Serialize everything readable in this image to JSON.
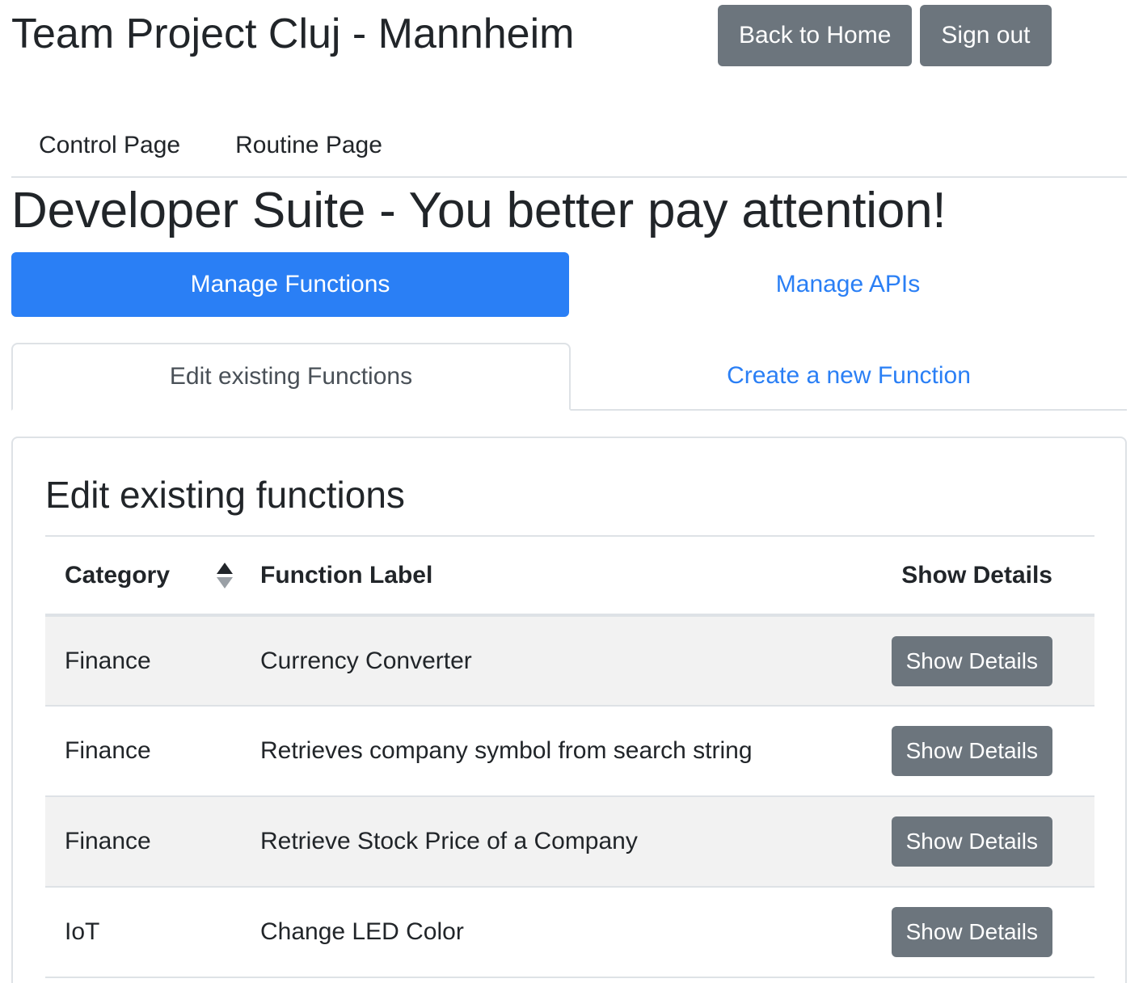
{
  "header": {
    "title": "Team Project Cluj - Mannheim",
    "back_home_label": "Back to Home",
    "sign_out_label": "Sign out"
  },
  "nav": {
    "items": [
      {
        "label": "Control Page"
      },
      {
        "label": "Routine Page"
      }
    ]
  },
  "suite_title": "Developer Suite - You better pay attention!",
  "pills": {
    "active_label": "Manage Functions",
    "inactive_label": "Manage APIs"
  },
  "tabs": {
    "active_label": "Edit existing Functions",
    "inactive_label": "Create a new Function"
  },
  "card": {
    "title": "Edit existing functions",
    "table": {
      "headers": {
        "category": "Category",
        "function_label": "Function Label",
        "show_details": "Show Details"
      },
      "sort_icon": "sort-icon",
      "rows": [
        {
          "category": "Finance",
          "function_label": "Currency Converter",
          "button": "Show Details"
        },
        {
          "category": "Finance",
          "function_label": "Retrieves company symbol from search string",
          "button": "Show Details"
        },
        {
          "category": "Finance",
          "function_label": "Retrieve Stock Price of a Company",
          "button": "Show Details"
        },
        {
          "category": "IoT",
          "function_label": "Change LED Color",
          "button": "Show Details"
        }
      ]
    }
  },
  "colors": {
    "primary": "#2a7ff5",
    "secondary_button": "#6c757d",
    "text": "#212529",
    "stripe": "#f2f2f2",
    "border": "#dee2e6"
  }
}
